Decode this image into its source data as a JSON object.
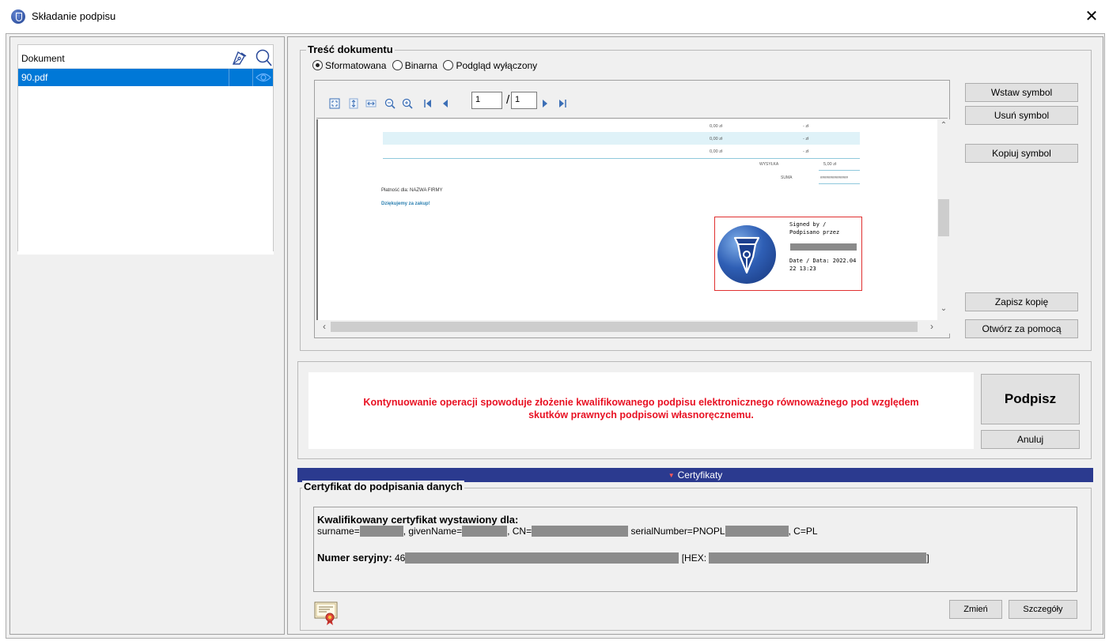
{
  "window": {
    "title": "Składanie podpisu",
    "close_glyph": "✕"
  },
  "documents": {
    "header_label": "Dokument",
    "sign_column_icon": "pen-nib-icon",
    "preview_column_icon": "magnifier-icon",
    "rows": [
      {
        "name": "90.pdf",
        "preview_icon": "eye-icon"
      }
    ]
  },
  "content": {
    "group_title": "Treść dokumentu",
    "view_modes": [
      {
        "label": "Sformatowana",
        "checked": true
      },
      {
        "label": "Binarna",
        "checked": false
      },
      {
        "label": "Podgląd wyłączony",
        "checked": false
      }
    ],
    "viewer": {
      "current_page": "1",
      "page_separator": "/",
      "total_pages": "1",
      "toolbar_icons": [
        "fit-page-icon",
        "fit-height-icon",
        "fit-width-icon",
        "zoom-out-icon",
        "zoom-in-icon",
        "first-page-icon",
        "previous-page-icon",
        "next-page-icon",
        "last-page-icon"
      ]
    },
    "document_preview": {
      "amount_1": "0,00 zł",
      "dash_1": "- zł",
      "amount_2": "0,00 zł",
      "dash_2": "- zł",
      "amount_3": "0,00 zł",
      "dash_3": "- zł",
      "shipping_label": "WYSYŁKA",
      "shipping_value": "5,00 zł",
      "total_label": "SUMA",
      "total_value": "##############",
      "payable_to": "Płatność dla: NAZWA FIRMY",
      "thanks": "Dziękujemy za zakup!",
      "stamp_signed_by": "Signed by /",
      "stamp_signed_by_pl": "Podpisano przez",
      "stamp_date": "Date / Data: 2022.04",
      "stamp_time": "22 13:23"
    },
    "side_buttons": {
      "insert": "Wstaw symbol",
      "remove": "Usuń symbol",
      "copy": "Kopiuj symbol",
      "save_copy": "Zapisz kopię",
      "open_with": "Otwórz za pomocą"
    }
  },
  "warning": {
    "line1": "Kontynuowanie operacji spowoduje złożenie kwalifikowanego podpisu elektronicznego równoważnego pod względem",
    "line2": "skutków prawnych podpisowi własnoręcznemu.",
    "color": "#e81123"
  },
  "actions": {
    "sign": "Podpisz",
    "cancel": "Anuluj"
  },
  "certificates": {
    "bar_label": "Certyfikaty",
    "bar_color": "#2b3a8f",
    "group_title": "Certyfikat do podpisania danych",
    "issued_for_label": "Kwalifikowany certyfikat wystawiony dla:",
    "surname_key": "surname=",
    "given_name_key": "givenName=",
    "cn_key": "CN=",
    "serial_number_key": "serialNumber=PNOPL",
    "country": "C=PL",
    "serial_label": "Numer seryjny:",
    "serial_prefix": "46",
    "hex_label": "[HEX:",
    "hex_close": "]",
    "certificate_icon": "certificate-icon",
    "change_button": "Zmień",
    "details_button": "Szczegóły"
  }
}
